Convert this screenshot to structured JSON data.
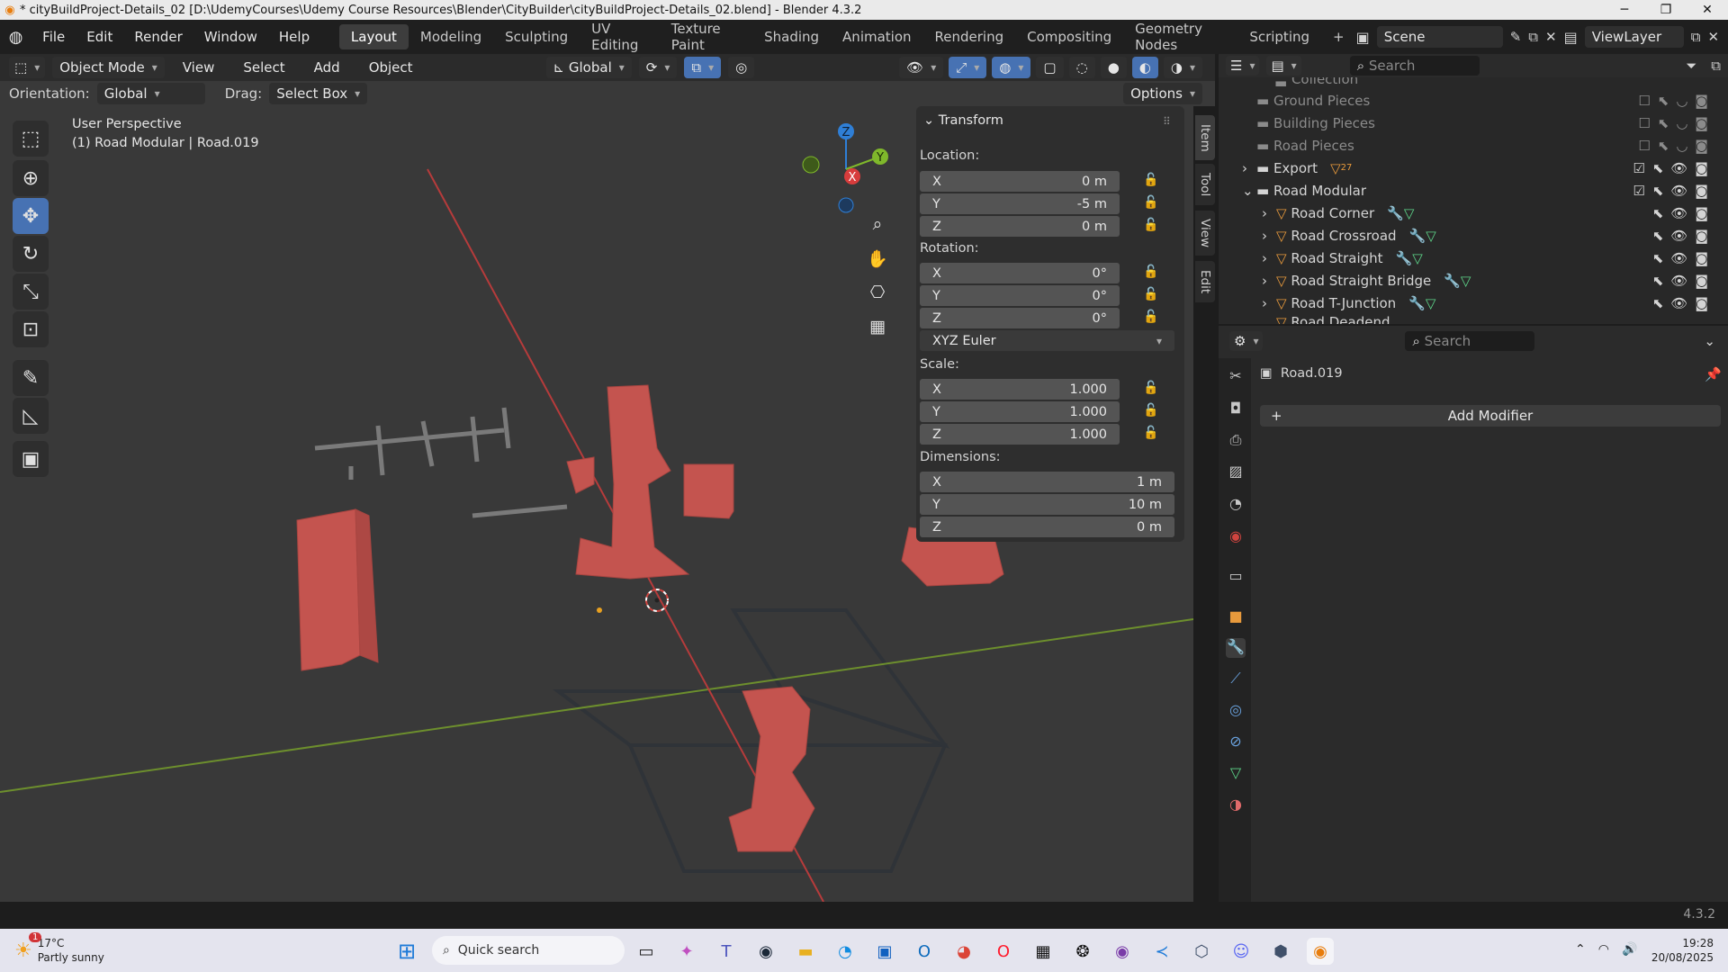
{
  "window": {
    "title": "* cityBuildProject-Details_02 [D:\\UdemyCourses\\Udemy Course Resources\\Blender\\CityBuilder\\cityBuildProject-Details_02.blend] - Blender 4.3.2"
  },
  "menus": [
    "File",
    "Edit",
    "Render",
    "Window",
    "Help"
  ],
  "workspaces": [
    "Layout",
    "Modeling",
    "Sculpting",
    "UV Editing",
    "Texture Paint",
    "Shading",
    "Animation",
    "Rendering",
    "Compositing",
    "Geometry Nodes",
    "Scripting"
  ],
  "active_workspace": "Layout",
  "scene": {
    "name": "Scene",
    "view_layer": "ViewLayer"
  },
  "viewport_header": {
    "mode": "Object Mode",
    "menus": [
      "View",
      "Select",
      "Add",
      "Object"
    ],
    "transform_orientation": "Global",
    "orientation_label": "Orientation:",
    "orientation_value": "Global",
    "drag_label": "Drag:",
    "drag_value": "Select Box",
    "options": "Options"
  },
  "viewport": {
    "perspective": "User Perspective",
    "object_info": "(1) Road Modular | Road.019",
    "gizmo": {
      "x": "X",
      "y": "Y",
      "z": "Z"
    }
  },
  "npanel": {
    "title": "Transform",
    "location_label": "Location:",
    "location": [
      {
        "axis": "X",
        "value": "0 m"
      },
      {
        "axis": "Y",
        "value": "-5 m"
      },
      {
        "axis": "Z",
        "value": "0 m"
      }
    ],
    "rotation_label": "Rotation:",
    "rotation": [
      {
        "axis": "X",
        "value": "0°"
      },
      {
        "axis": "Y",
        "value": "0°"
      },
      {
        "axis": "Z",
        "value": "0°"
      }
    ],
    "rotation_mode": "XYZ Euler",
    "scale_label": "Scale:",
    "scale": [
      {
        "axis": "X",
        "value": "1.000"
      },
      {
        "axis": "Y",
        "value": "1.000"
      },
      {
        "axis": "Z",
        "value": "1.000"
      }
    ],
    "dimensions_label": "Dimensions:",
    "dimensions": [
      {
        "axis": "X",
        "value": "1 m"
      },
      {
        "axis": "Y",
        "value": "10 m"
      },
      {
        "axis": "Z",
        "value": "0 m"
      }
    ],
    "tabs": [
      "Item",
      "Tool",
      "View",
      "Edit"
    ]
  },
  "outliner": {
    "search_placeholder": "Search",
    "rows": [
      {
        "label": "Collection",
        "dim": true
      },
      {
        "label": "Ground Pieces",
        "dim": true
      },
      {
        "label": "Building Pieces",
        "dim": true
      },
      {
        "label": "Road Pieces",
        "dim": true
      },
      {
        "label": "Export",
        "dim": false,
        "badge": "27"
      },
      {
        "label": "Road Modular",
        "dim": false
      },
      {
        "label": "Road Corner",
        "dim": false
      },
      {
        "label": "Road Crossroad",
        "dim": false
      },
      {
        "label": "Road Straight",
        "dim": false
      },
      {
        "label": "Road Straight Bridge",
        "dim": false
      },
      {
        "label": "Road T-Junction",
        "dim": false
      },
      {
        "label": "Road Deadend",
        "dim": false
      }
    ]
  },
  "properties": {
    "search_placeholder": "Search",
    "object_name": "Road.019",
    "add_modifier": "Add Modifier"
  },
  "status": {
    "version": "4.3.2"
  },
  "taskbar": {
    "weather_temp": "17°C",
    "weather_desc": "Partly sunny",
    "weather_badge": "1",
    "search_placeholder": "Quick search",
    "time": "19:28",
    "date": "20/08/2025"
  },
  "colors": {
    "accent": "#4772b3",
    "object_red": "#c4544f",
    "axis_x": "#d73c3c",
    "axis_y": "#7fb82b",
    "axis_z": "#2f7fd6"
  }
}
